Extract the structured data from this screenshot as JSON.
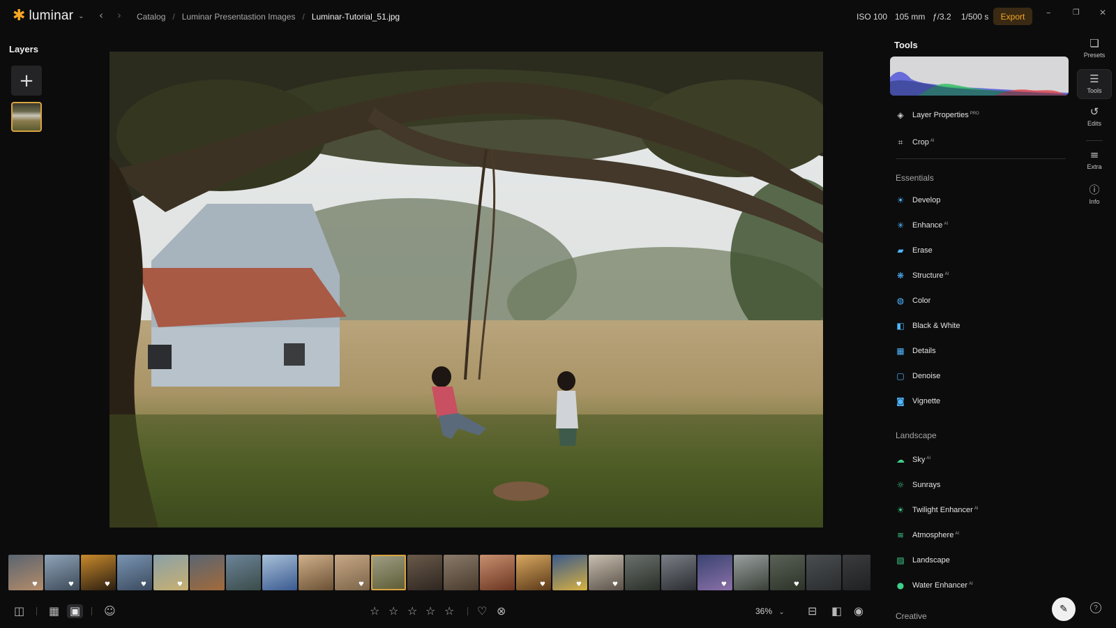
{
  "app": {
    "logo_text": "luminar",
    "logo_icon": "sun-star-icon",
    "accent_color": "#f5a623"
  },
  "breadcrumb": {
    "catalog": "Catalog",
    "folder": "Luminar Presentastion Images",
    "file": "Luminar-Tutorial_51.jpg",
    "separator": "/"
  },
  "exif": {
    "iso": "ISO 100",
    "focal": "105 mm",
    "aperture": "ƒ/3.2",
    "shutter": "1/500 s"
  },
  "toolbar": {
    "export_label": "Export"
  },
  "window": {
    "minimize": "–",
    "restore": "❐",
    "close": "✕"
  },
  "layers": {
    "title": "Layers",
    "add_label": "+"
  },
  "tools": {
    "title": "Tools",
    "top_items": [
      {
        "label": "Layer Properties",
        "badge": "PRO",
        "icon": "layers-icon"
      },
      {
        "label": "Crop",
        "badge": "AI",
        "icon": "crop-icon"
      }
    ],
    "sections": [
      {
        "title": "Essentials",
        "items": [
          {
            "label": "Develop",
            "badge": "",
            "icon": "develop-icon",
            "color": "#4fb7ff"
          },
          {
            "label": "Enhance",
            "badge": "AI",
            "icon": "enhance-icon",
            "color": "#4fb7ff"
          },
          {
            "label": "Erase",
            "badge": "",
            "icon": "erase-icon",
            "color": "#4fb7ff"
          },
          {
            "label": "Structure",
            "badge": "AI",
            "icon": "structure-icon",
            "color": "#4fb7ff"
          },
          {
            "label": "Color",
            "badge": "",
            "icon": "color-icon",
            "color": "#4fb7ff"
          },
          {
            "label": "Black & White",
            "badge": "",
            "icon": "black-white-icon",
            "color": "#4fb7ff"
          },
          {
            "label": "Details",
            "badge": "",
            "icon": "details-icon",
            "color": "#4fb7ff"
          },
          {
            "label": "Denoise",
            "badge": "",
            "icon": "denoise-icon",
            "color": "#4fb7ff"
          },
          {
            "label": "Vignette",
            "badge": "",
            "icon": "vignette-icon",
            "color": "#4fb7ff"
          }
        ]
      },
      {
        "title": "Landscape",
        "items": [
          {
            "label": "Sky",
            "badge": "AI",
            "icon": "sky-icon",
            "color": "#3fd08a"
          },
          {
            "label": "Sunrays",
            "badge": "",
            "icon": "sunrays-icon",
            "color": "#3fd08a"
          },
          {
            "label": "Twilight Enhancer",
            "badge": "AI",
            "icon": "twilight-icon",
            "color": "#3fd08a"
          },
          {
            "label": "Atmosphere",
            "badge": "AI",
            "icon": "atmosphere-icon",
            "color": "#3fd08a"
          },
          {
            "label": "Landscape",
            "badge": "",
            "icon": "landscape-icon",
            "color": "#3fd08a"
          },
          {
            "label": "Water Enhancer",
            "badge": "AI",
            "icon": "water-icon",
            "color": "#3fd08a"
          }
        ]
      },
      {
        "title": "Creative",
        "items": []
      }
    ]
  },
  "rail": [
    {
      "label": "Presets",
      "icon": "presets-icon",
      "active": false
    },
    {
      "label": "Tools",
      "icon": "tools-sliders-icon",
      "active": true
    },
    {
      "label": "Edits",
      "icon": "history-icon",
      "active": false
    },
    {
      "label": "Extra",
      "icon": "list-icon",
      "active": false
    },
    {
      "label": "Info",
      "icon": "info-icon",
      "active": false
    }
  ],
  "bottom": {
    "zoom": "36%",
    "rating_stars": 5,
    "rating_value": 0
  },
  "filmstrip": [
    {
      "c1": "#5a6470",
      "c2": "#b38c6a",
      "fav": true
    },
    {
      "c1": "#8fa3b8",
      "c2": "#3c4a58",
      "fav": true
    },
    {
      "c1": "#c88a2c",
      "c2": "#2a1d10",
      "fav": true
    },
    {
      "c1": "#7a94b2",
      "c2": "#3a4a5e",
      "fav": true
    },
    {
      "c1": "#8aa0a8",
      "c2": "#c8b070",
      "fav": true
    },
    {
      "c1": "#5a6572",
      "c2": "#a26a3a",
      "fav": false
    },
    {
      "c1": "#6c8498",
      "c2": "#3a4c4a",
      "fav": false
    },
    {
      "c1": "#a8c0d8",
      "c2": "#3a5a90",
      "fav": false
    },
    {
      "c1": "#d0b08a",
      "c2": "#6a5034",
      "fav": false
    },
    {
      "c1": "#c8a886",
      "c2": "#7a6448",
      "fav": true
    },
    {
      "c1": "#a0a088",
      "c2": "#5c5a32",
      "fav": false
    },
    {
      "c1": "#6a5a4a",
      "c2": "#2e2620",
      "fav": false
    },
    {
      "c1": "#8a7a6a",
      "c2": "#4a3a2c",
      "fav": false
    },
    {
      "c1": "#c89070",
      "c2": "#6a3420",
      "fav": false
    },
    {
      "c1": "#d8a860",
      "c2": "#5a3818",
      "fav": true
    },
    {
      "c1": "#3a5a8c",
      "c2": "#d8b040",
      "fav": true
    },
    {
      "c1": "#c8c0b0",
      "c2": "#5a5048",
      "fav": true
    },
    {
      "c1": "#6a706c",
      "c2": "#2a3028",
      "fav": false
    },
    {
      "c1": "#7a7e86",
      "c2": "#2a2c30",
      "fav": false
    },
    {
      "c1": "#3a4470",
      "c2": "#8a70a8",
      "fav": true
    },
    {
      "c1": "#9aa0a0",
      "c2": "#3a4038",
      "fav": false
    },
    {
      "c1": "#5a6258",
      "c2": "#2c3228",
      "fav": true
    },
    {
      "c1": "#4a4e50",
      "c2": "#2a2c2e",
      "fav": false
    },
    {
      "c1": "#3a3c3e",
      "c2": "#1e1f20",
      "fav": false
    }
  ]
}
